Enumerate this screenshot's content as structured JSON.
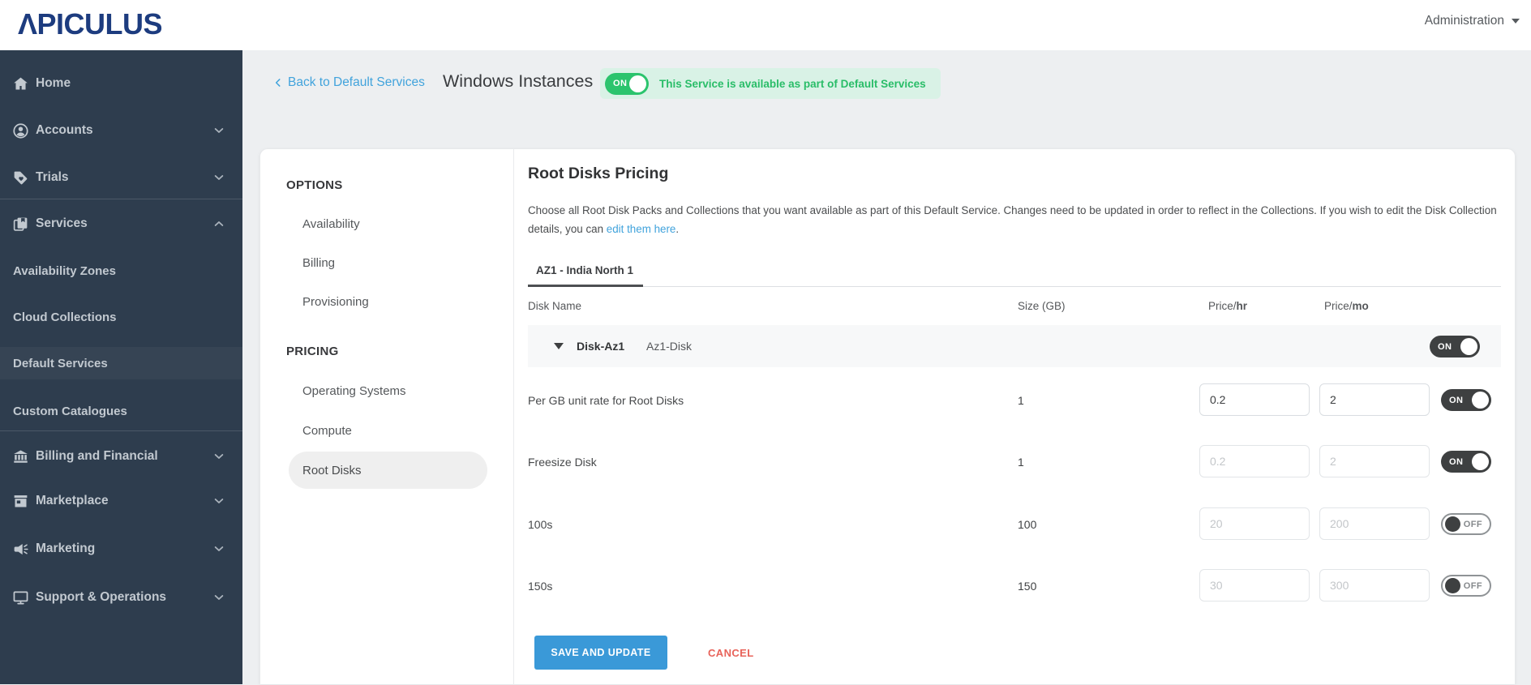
{
  "topbar": {
    "logo": "ΛPICULUS",
    "admin_label": "Administration"
  },
  "sidebar": {
    "items": [
      {
        "label": "Home"
      },
      {
        "label": "Accounts"
      },
      {
        "label": "Trials"
      },
      {
        "label": "Services"
      },
      {
        "label": "Availability Zones"
      },
      {
        "label": "Cloud Collections"
      },
      {
        "label": "Default Services"
      },
      {
        "label": "Custom Catalogues"
      },
      {
        "label": "Billing and Financial"
      },
      {
        "label": "Marketplace"
      },
      {
        "label": "Marketing"
      },
      {
        "label": "Support & Operations"
      }
    ]
  },
  "header": {
    "back_label": "Back to Default Services",
    "title": "Windows Instances",
    "service_toggle": "ON",
    "service_status": "This Service is available as part of Default Services"
  },
  "nav_panel": {
    "options_title": "OPTIONS",
    "options": [
      "Availability",
      "Billing",
      "Provisioning"
    ],
    "pricing_title": "PRICING",
    "pricing": [
      "Operating Systems",
      "Compute",
      "Root Disks"
    ]
  },
  "main": {
    "title": "Root Disks Pricing",
    "description_before": "Choose all Root Disk Packs and Collections that you want available as part of this Default Service. Changes need to be updated in order to reflect in the Collections. If you wish to edit the Disk Collection details, you can ",
    "description_link": "edit them here",
    "description_after": ".",
    "tab": "AZ1 - India North 1",
    "table": {
      "headers": {
        "disk_name": "Disk Name",
        "size": "Size (GB)",
        "price_prefix": "Price/",
        "hr": "hr",
        "mo": "mo"
      },
      "group": {
        "name": "Disk-Az1",
        "subtitle": "Az1-Disk",
        "toggle": "ON"
      },
      "rows": [
        {
          "name": "Per GB unit rate for Root Disks",
          "size": "1",
          "price_hr": "0.2",
          "price_mo": "2",
          "toggle": "ON"
        },
        {
          "name": "Freesize Disk",
          "size": "1",
          "price_hr": "0.2",
          "price_mo": "2",
          "toggle": "ON"
        },
        {
          "name": "100s",
          "size": "100",
          "price_hr": "20",
          "price_mo": "200",
          "toggle": "OFF"
        },
        {
          "name": "150s",
          "size": "150",
          "price_hr": "30",
          "price_mo": "300",
          "toggle": "OFF"
        }
      ]
    },
    "save_label": "SAVE AND UPDATE",
    "cancel_label": "CANCEL"
  },
  "colors": {
    "sidebar": "#2e3d4e",
    "logo_navy": "#1d3c7f",
    "link_blue": "#41a3dc",
    "green": "#2bc46d",
    "green_badge_bg": "#d9f2e6",
    "button_blue": "#3a99d8",
    "cancel_red": "#e8635a"
  }
}
